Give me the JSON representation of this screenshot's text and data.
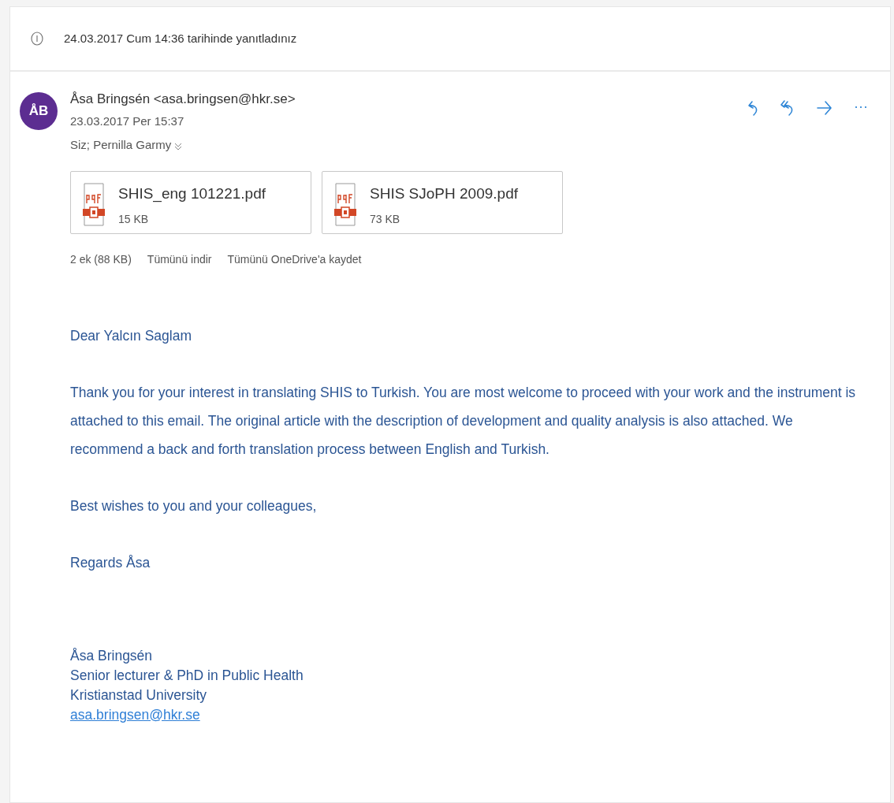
{
  "notice": {
    "text": "24.03.2017 Cum 14:36 tarihinde yanıtladınız"
  },
  "message": {
    "avatar": {
      "initials": "ÅB",
      "color": "#5c2d91"
    },
    "sender": "Åsa Bringsén <asa.bringsen@hkr.se>",
    "date": "23.03.2017 Per 15:37",
    "recipients": "Siz; Pernilla Garmy",
    "recipients_expanded": false,
    "actions": [
      {
        "kind": "reply"
      },
      {
        "kind": "reply_all"
      },
      {
        "kind": "forward"
      },
      {
        "kind": "more",
        "label": "···"
      }
    ],
    "attachments": [
      {
        "name": "SHIS_eng 101221.pdf",
        "size": "15 KB"
      },
      {
        "name": "SHIS SJoPH 2009.pdf",
        "size": "73 KB"
      }
    ],
    "attachment_summary": "2 ek (88 KB)",
    "attachment_links": [
      "Tümünü indir",
      "Tümünü OneDrive'a kaydet"
    ],
    "body": [
      {
        "kind": "paragraph",
        "text": "Dear Yalcın Saglam"
      },
      {
        "kind": "paragraph",
        "text": "Thank you for your interest in translating SHIS to Turkish. You are most welcome to proceed with your work and the instrument is attached to this email. The original article with the description of development and quality analysis is also attached. We recommend a back and forth translation process between English and Turkish."
      },
      {
        "kind": "paragraph",
        "text": "Best wishes to you and your colleagues,"
      },
      {
        "kind": "paragraph",
        "text": "Regards Åsa"
      }
    ],
    "signature": [
      {
        "kind": "line",
        "text": "Åsa Bringsén"
      },
      {
        "kind": "line",
        "text": "Senior lecturer & PhD in Public Health"
      },
      {
        "kind": "line",
        "text": "Kristianstad University"
      },
      {
        "kind": "link",
        "text": "asa.bringsen@hkr.se"
      }
    ]
  }
}
